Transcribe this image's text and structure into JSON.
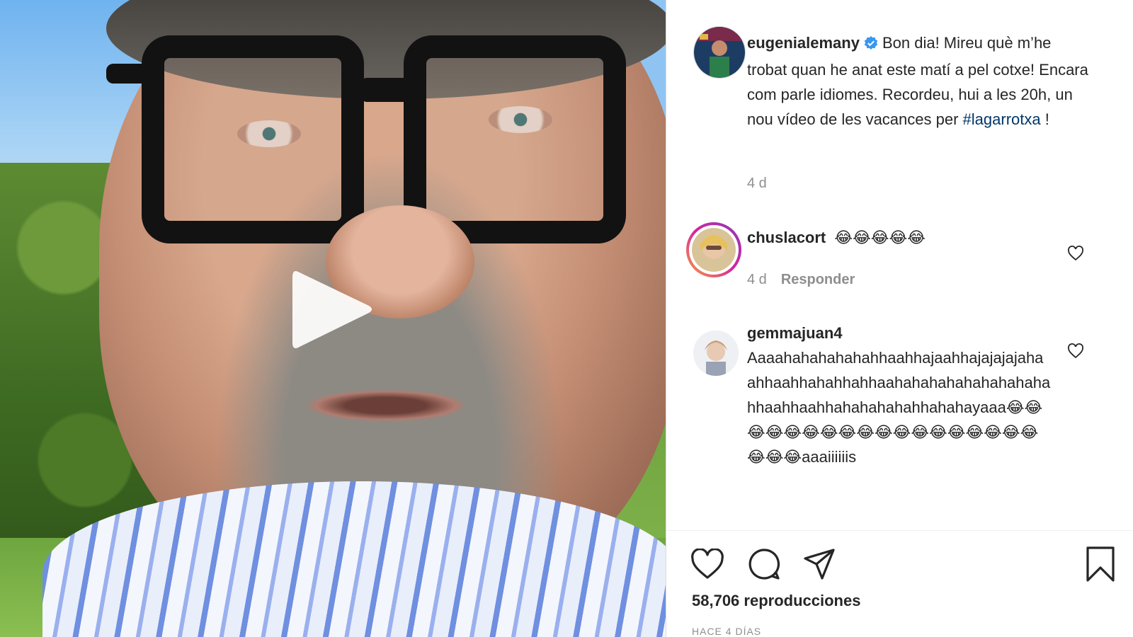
{
  "post": {
    "author": "eugenialemany",
    "verified": true,
    "caption_text": "Bon dia! Mireu què m’he trobat quan he anat este matí a pel cotxe! Encara com parle idiomes. Recordeu, hui a les 20h, un nou vídeo de les vacances per",
    "hashtag": "#lagarrotxa",
    "caption_end": " !",
    "age": "4 d"
  },
  "comments": [
    {
      "username": "chuslacort",
      "text": "😂😂😂😂😂",
      "age": "4 d",
      "reply_label": "Responder"
    },
    {
      "username": "gemmajuan4",
      "text": "Aaaahahahahahahhaahhajaahhajajajajahaahhaahhahahhahhaahahahahahahahahahahhaahhaahhahahahahahhahahayaaa😂😂😂😂😂😂😂😂😂😂😂😂😂😂😂😂😂😂😂😂😂aaaiiiiiis"
    }
  ],
  "footer": {
    "views": "58,706 reproducciones",
    "date": "HACE 4 DÍAS"
  },
  "icons": {
    "play": "play-icon",
    "like": "heart-icon",
    "comment": "comment-icon",
    "share": "paper-plane-icon",
    "save": "bookmark-icon",
    "verified": "verified-badge-icon"
  },
  "colors": {
    "verified": "#3897f0",
    "hashtag": "#00376b",
    "meta": "#8e8e8e",
    "story_ring": "#d6249f"
  }
}
